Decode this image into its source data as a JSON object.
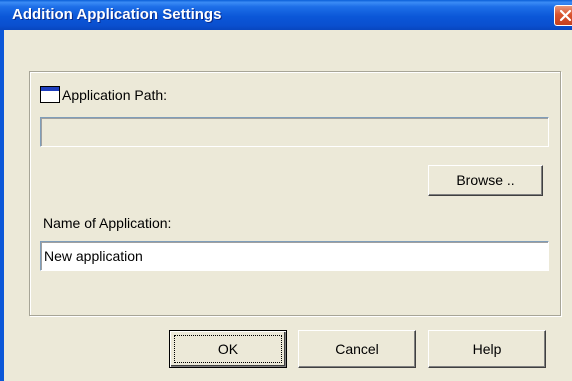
{
  "window": {
    "title": "Addition Application Settings"
  },
  "form": {
    "path_label": "Application Path:",
    "path_value": "",
    "browse_label": "Browse ..",
    "name_label": "Name of Application:",
    "name_value": "New application"
  },
  "buttons": {
    "ok_label": "OK",
    "cancel_label": "Cancel",
    "help_label": "Help"
  },
  "icons": {
    "close": "close-icon",
    "path": "window-icon"
  },
  "colors": {
    "titlebar": "#0b57d8",
    "dialog_bg": "#ece9d8",
    "close_button": "#d9542e"
  }
}
